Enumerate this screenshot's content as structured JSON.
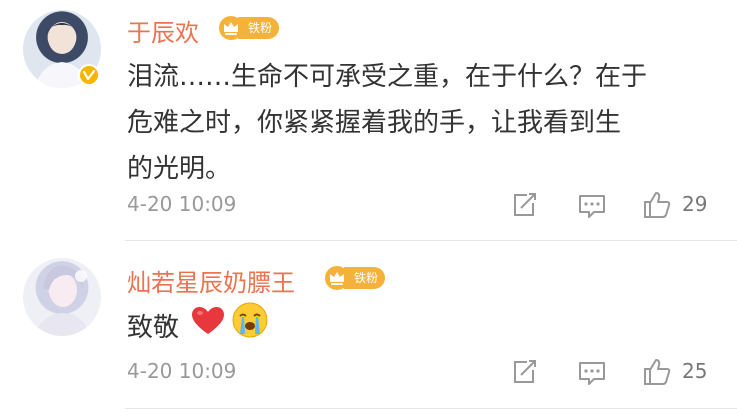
{
  "comments": [
    {
      "username": "于辰欢",
      "badge": "铁粉",
      "text_lines": [
        "泪流……生命不可承受之重，在于什么？在于",
        "危难之时，你紧紧握着我的手，让我看到生",
        "的光明。"
      ],
      "timestamp": "4-20 10:09",
      "likes": "29"
    },
    {
      "username": "灿若星辰奶膘王",
      "badge": "铁粉",
      "text": "致敬",
      "emojis": [
        "red-heart-icon",
        "crying-face-icon"
      ],
      "timestamp": "4-20 10:09",
      "likes": "25"
    }
  ],
  "colors": {
    "username": "#eb7350",
    "badge": "#f4b23a",
    "verified": "#f7b500",
    "meta": "#999999"
  }
}
